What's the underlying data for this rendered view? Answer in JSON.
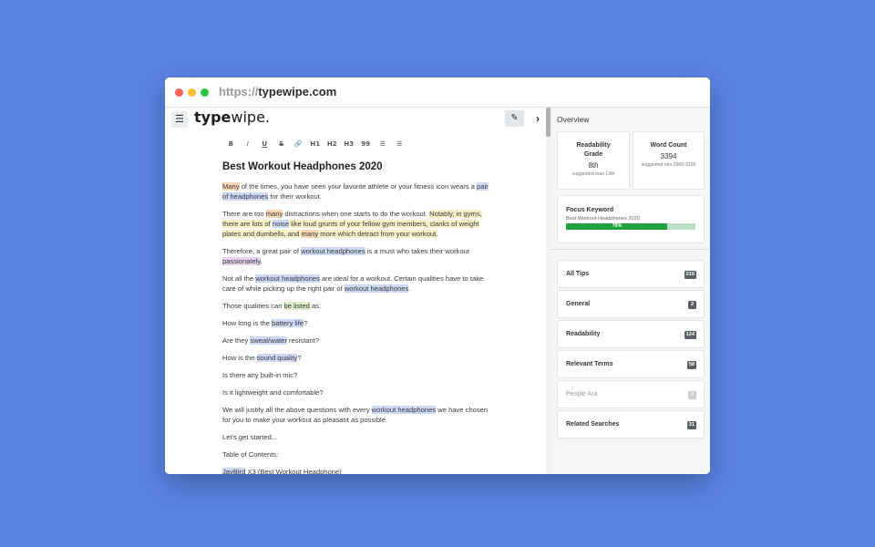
{
  "browser": {
    "url_protocol": "https://",
    "url_host": "typewipe.com"
  },
  "app": {
    "logo_bold": "type",
    "logo_rest": "wipe."
  },
  "toolbar": {
    "bold": "B",
    "italic": "I",
    "underline": "U",
    "strike": "S",
    "link": "🔗",
    "h1": "H1",
    "h2": "H2",
    "h3": "H3",
    "quote": "99",
    "bullets": "☰",
    "numbered": "☰"
  },
  "document": {
    "title": "Best Workout Headphones 2020",
    "paragraphs": [
      [
        {
          "t": "Many",
          "h": "ho"
        },
        {
          "t": " of the times, you have seen your favorite athlete or your fitness icon wears a "
        },
        {
          "t": "pair of headphones",
          "h": "hb"
        },
        {
          "t": " for their workout."
        }
      ],
      [
        {
          "t": "There are too "
        },
        {
          "t": "many",
          "h": "ho"
        },
        {
          "t": " distractions when one starts to do the workout. "
        },
        {
          "t": "Notably, in gyms, there are lots of",
          "h": "hy"
        },
        {
          "t": " "
        },
        {
          "t": "noise",
          "h": "hb"
        },
        {
          "t": " like loud grunts of your fellow gym members, clanks of weight plates and dumbells, and ",
          "h": "hy"
        },
        {
          "t": "many",
          "h": "ho"
        },
        {
          "t": " more which detract from your workout.",
          "h": "hy"
        }
      ],
      [
        {
          "t": "Therefore, a great pair of "
        },
        {
          "t": "workout headphones",
          "h": "hb"
        },
        {
          "t": " is a must who takes their workout "
        },
        {
          "t": "passionately",
          "h": "hp"
        },
        {
          "t": "."
        }
      ],
      [
        {
          "t": "Not all the "
        },
        {
          "t": "workout headphones",
          "h": "hb"
        },
        {
          "t": " are ideal for a workout. Certain qualities have to take care of while picking up the right pair of "
        },
        {
          "t": "workout headphones",
          "h": "hb"
        },
        {
          "t": "."
        }
      ],
      [
        {
          "t": "Those qualities can "
        },
        {
          "t": "be listed",
          "h": "hg"
        },
        {
          "t": " as:"
        }
      ],
      [
        {
          "t": "How long is the "
        },
        {
          "t": "battery life",
          "h": "hb"
        },
        {
          "t": "?"
        }
      ],
      [
        {
          "t": "Are they "
        },
        {
          "t": "sweat/water",
          "h": "hb"
        },
        {
          "t": " resistant?"
        }
      ],
      [
        {
          "t": "How is the "
        },
        {
          "t": "sound quality",
          "h": "hb"
        },
        {
          "t": "?"
        }
      ],
      [
        {
          "t": "Is there any built-in mic?"
        }
      ],
      [
        {
          "t": "Is it lightweight and comfortable?"
        }
      ],
      [
        {
          "t": "We will justify all the above questions with every "
        },
        {
          "t": "workout headphones",
          "h": "hb"
        },
        {
          "t": " we have chosen for you to make your workout as pleasant as possible."
        }
      ],
      [
        {
          "t": "Let's get started..."
        }
      ],
      [
        {
          "t": "Table of Contents:"
        }
      ],
      [
        {
          "t": "JayBird",
          "h": "hb"
        },
        {
          "t": " X3 (Best Workout Headphone)"
        }
      ]
    ]
  },
  "overview": {
    "title": "Overview",
    "readability": {
      "label": "Readability Grade",
      "value": "8th",
      "sub": "suggested max 13th"
    },
    "word_count": {
      "label": "Word Count",
      "value": "3394",
      "sub": "suggested min 2900-3100"
    },
    "focus": {
      "label": "Focus Keyword",
      "keyword": "Best Workout Headphones 2020",
      "progress_percent": 78,
      "progress_text": "78%"
    }
  },
  "tips": [
    {
      "label": "All Tips",
      "count": "215",
      "muted": false
    },
    {
      "label": "General",
      "count": "2",
      "muted": false
    },
    {
      "label": "Readability",
      "count": "124",
      "muted": false
    },
    {
      "label": "Relevant Terms",
      "count": "58",
      "muted": false
    },
    {
      "label": "People Ask",
      "count": "0",
      "muted": true
    },
    {
      "label": "Related Searches",
      "count": "31",
      "muted": false
    }
  ],
  "colors": {
    "background": "#5b83e3",
    "progress": "#20a13d",
    "highlight_blue": "#cdd9f7",
    "highlight_orange": "#fbd8b5",
    "highlight_yellow": "#f8f0c6",
    "highlight_purple": "#e7d2f1",
    "highlight_green": "#dcefc6"
  }
}
